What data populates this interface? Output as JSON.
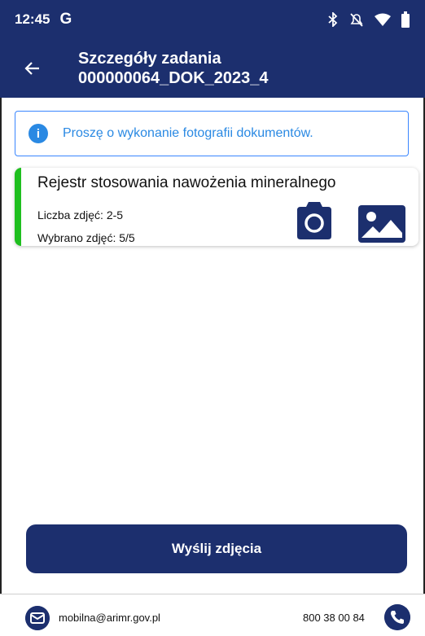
{
  "status_bar": {
    "time": "12:45",
    "google_letter": "G",
    "icons": [
      "bluetooth-icon",
      "do-not-disturb-icon",
      "wifi-icon",
      "battery-icon"
    ]
  },
  "header": {
    "title_line1": "Szczegóły zadania",
    "title_line2": "000000064_DOK_2023_4",
    "back_icon": "back-arrow-icon"
  },
  "info_banner": {
    "icon": "info-icon",
    "icon_glyph": "i",
    "text": "Proszę o wykonanie fotografii dokumentów."
  },
  "document_card": {
    "title": "Rejestr stosowania nawożenia mineralnego",
    "photo_count_label": "Liczba zdjęć: 2-5",
    "selected_label": "Wybrano zdjęć: 5/5",
    "status_color": "#1fbf1f",
    "camera_icon": "camera-icon",
    "gallery_icon": "gallery-icon"
  },
  "actions": {
    "send_label": "Wyślij zdjęcia"
  },
  "footer": {
    "email": "mobilna@arimr.gov.pl",
    "phone": "800 38 00 84"
  },
  "colors": {
    "primary": "#1c2f6e",
    "info": "#2a89e3",
    "success": "#1fbf1f"
  }
}
